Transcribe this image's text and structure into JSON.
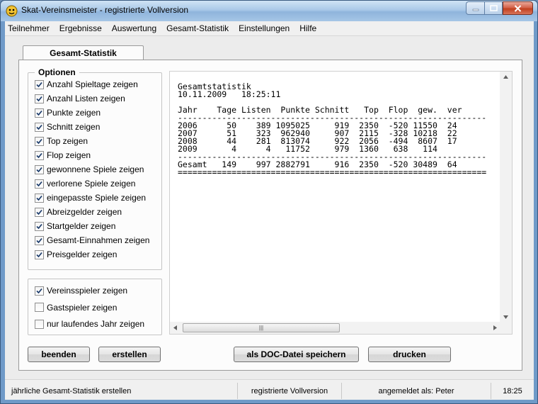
{
  "window": {
    "title": "Skat-Vereinsmeister - registrierte Vollversion"
  },
  "menu": {
    "items": [
      "Teilnehmer",
      "Ergebnisse",
      "Auswertung",
      "Gesamt-Statistik",
      "Einstellungen",
      "Hilfe"
    ]
  },
  "tab": {
    "label": "Gesamt-Statistik"
  },
  "options": {
    "title": "Optionen",
    "items": [
      {
        "label": "Anzahl Spieltage zeigen",
        "checked": true
      },
      {
        "label": "Anzahl Listen zeigen",
        "checked": true
      },
      {
        "label": "Punkte zeigen",
        "checked": true
      },
      {
        "label": "Schnitt zeigen",
        "checked": true
      },
      {
        "label": "Top zeigen",
        "checked": true
      },
      {
        "label": "Flop zeigen",
        "checked": true
      },
      {
        "label": "gewonnene Spiele zeigen",
        "checked": true
      },
      {
        "label": "verlorene Spiele zeigen",
        "checked": true
      },
      {
        "label": "eingepasste Spiele zeigen",
        "checked": true
      },
      {
        "label": "Abreizgelder zeigen",
        "checked": true
      },
      {
        "label": "Startgelder zeigen",
        "checked": true
      },
      {
        "label": "Gesamt-Einnahmen zeigen",
        "checked": true
      },
      {
        "label": "Preisgelder zeigen",
        "checked": true
      }
    ]
  },
  "players": {
    "items": [
      {
        "label": "Vereinsspieler zeigen",
        "checked": true
      },
      {
        "label": "Gastspieler zeigen",
        "checked": false
      },
      {
        "label": "nur laufendes Jahr zeigen",
        "checked": false
      }
    ]
  },
  "report": {
    "text": "Gesamtstatistik\n10.11.2009   18:25:11\n\nJahr    Tage Listen  Punkte Schnitt   Top  Flop  gew.  ver\n---------------------------------------------------------------\n2006      50    389 1095025     919  2350  -520 11550  24\n2007      51    323  962940     907  2115  -328 10218  22\n2008      44    281  813074     922  2056  -494  8607  17\n2009       4      4   11752     979  1360   638   114\n---------------------------------------------------------------\nGesamt   149    997 2882791     916  2350  -520 30489  64\n===============================================================",
    "scroll_thumb_glyph": "|||"
  },
  "buttons": {
    "quit": "beenden",
    "create": "erstellen",
    "save_doc": "als DOC-Datei speichern",
    "print": "drucken"
  },
  "status": {
    "message": "jährliche Gesamt-Statistik erstellen",
    "license": "registrierte Vollversion",
    "user": "angemeldet als: Peter",
    "time": "18:25"
  }
}
